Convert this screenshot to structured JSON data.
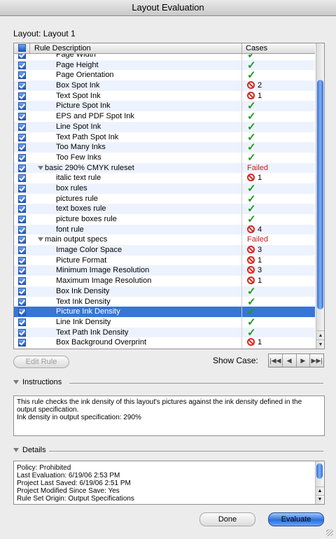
{
  "window": {
    "title": "Layout Evaluation"
  },
  "layout_label": "Layout: Layout 1",
  "table": {
    "headers": {
      "description": "Rule Description",
      "cases": "Cases"
    },
    "rows": [
      {
        "label": "Page Width",
        "indent": 2,
        "status": "ok",
        "count": ""
      },
      {
        "label": "Page Height",
        "indent": 2,
        "status": "ok",
        "count": ""
      },
      {
        "label": "Page Orientation",
        "indent": 2,
        "status": "ok",
        "count": ""
      },
      {
        "label": "Box Spot Ink",
        "indent": 2,
        "status": "fail",
        "count": "2"
      },
      {
        "label": "Text Spot Ink",
        "indent": 2,
        "status": "fail",
        "count": "1"
      },
      {
        "label": "Picture Spot Ink",
        "indent": 2,
        "status": "ok",
        "count": ""
      },
      {
        "label": "EPS and PDF Spot Ink",
        "indent": 2,
        "status": "ok",
        "count": ""
      },
      {
        "label": "Line Spot Ink",
        "indent": 2,
        "status": "ok",
        "count": ""
      },
      {
        "label": "Text Path Spot Ink",
        "indent": 2,
        "status": "ok",
        "count": ""
      },
      {
        "label": "Too Many Inks",
        "indent": 2,
        "status": "ok",
        "count": ""
      },
      {
        "label": "Too Few Inks",
        "indent": 2,
        "status": "ok",
        "count": ""
      },
      {
        "label": "basic 290% CMYK ruleset",
        "indent": 1,
        "status": "group-failed",
        "count": "Failed"
      },
      {
        "label": "italic text rule",
        "indent": 2,
        "status": "fail",
        "count": "1"
      },
      {
        "label": "box rules",
        "indent": 2,
        "status": "ok",
        "count": ""
      },
      {
        "label": "pictures rule",
        "indent": 2,
        "status": "ok",
        "count": ""
      },
      {
        "label": "text boxes rule",
        "indent": 2,
        "status": "ok",
        "count": ""
      },
      {
        "label": "picture boxes rule",
        "indent": 2,
        "status": "ok",
        "count": ""
      },
      {
        "label": "font rule",
        "indent": 2,
        "status": "fail",
        "count": "4"
      },
      {
        "label": "main output specs",
        "indent": 1,
        "status": "group-failed",
        "count": "Failed"
      },
      {
        "label": "Image Color Space",
        "indent": 2,
        "status": "fail",
        "count": "3"
      },
      {
        "label": "Picture Format",
        "indent": 2,
        "status": "fail",
        "count": "1"
      },
      {
        "label": "Minimum Image Resolution",
        "indent": 2,
        "status": "fail",
        "count": "3"
      },
      {
        "label": "Maximum Image Resolution",
        "indent": 2,
        "status": "fail",
        "count": "1"
      },
      {
        "label": "Box Ink Density",
        "indent": 2,
        "status": "ok",
        "count": ""
      },
      {
        "label": "Text Ink Density",
        "indent": 2,
        "status": "ok",
        "count": ""
      },
      {
        "label": "Picture Ink Density",
        "indent": 2,
        "status": "ok",
        "count": "",
        "selected": true
      },
      {
        "label": "Line Ink Density",
        "indent": 2,
        "status": "ok",
        "count": ""
      },
      {
        "label": "Text Path Ink Density",
        "indent": 2,
        "status": "ok",
        "count": ""
      },
      {
        "label": "Box Background Overprint",
        "indent": 2,
        "status": "fail",
        "count": "1"
      }
    ]
  },
  "buttons": {
    "edit_rule": "Edit Rule",
    "done": "Done",
    "evaluate": "Evaluate"
  },
  "show_case": {
    "label": "Show Case:",
    "nav": [
      "first",
      "previous",
      "next",
      "last"
    ]
  },
  "instructions": {
    "title": "Instructions",
    "text1": "This rule checks the ink density of this layout's pictures against the ink density defined in the output specification.",
    "text2": "Ink density in output specification: 290%"
  },
  "details": {
    "title": "Details",
    "lines": [
      "Policy: Prohibited",
      "Last Evaluation: 6/19/06  2:53 PM",
      "Project Last Saved: 6/19/06  2:51 PM",
      "Project Modified Since Save: Yes",
      "Rule Set Origin: Output Specifications"
    ]
  },
  "colors": {
    "selection": "#3875d7",
    "failed": "#cc1d1d",
    "ok": "#1f9a1f"
  }
}
